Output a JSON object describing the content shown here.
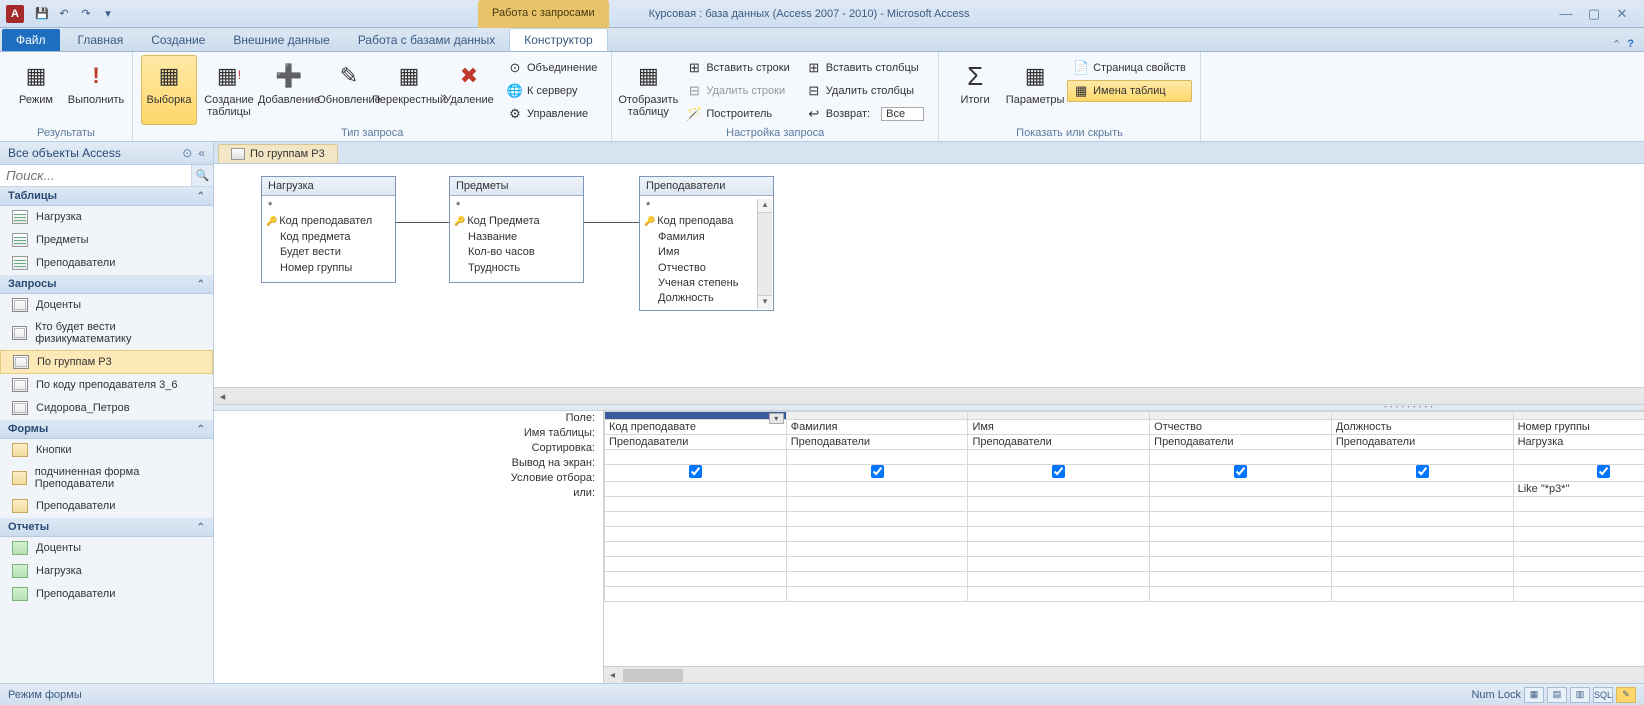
{
  "titlebar": {
    "app_letter": "A",
    "context_tab": "Работа с запросами",
    "title": "Курсовая : база данных (Access 2007 - 2010)  -  Microsoft Access"
  },
  "tabs": {
    "file": "Файл",
    "home": "Главная",
    "create": "Создание",
    "external": "Внешние данные",
    "dbtools": "Работа с базами данных",
    "design": "Конструктор"
  },
  "ribbon": {
    "results": {
      "view": "Режим",
      "run": "Выполнить",
      "label": "Результаты"
    },
    "qtype": {
      "select": "Выборка",
      "maketable": "Создание\nтаблицы",
      "append": "Добавление",
      "update": "Обновление",
      "crosstab": "Перекрестный",
      "delete": "Удаление",
      "union": "Объединение",
      "passthrough": "К серверу",
      "datadef": "Управление",
      "label": "Тип запроса"
    },
    "setup": {
      "showtable": "Отобразить\nтаблицу",
      "insrows": "Вставить строки",
      "delrows": "Удалить строки",
      "builder": "Построитель",
      "inscols": "Вставить столбцы",
      "delcols": "Удалить столбцы",
      "return": "Возврат:",
      "return_val": "Все",
      "label": "Настройка запроса"
    },
    "showhide": {
      "totals": "Итоги",
      "params": "Параметры",
      "propsheet": "Страница свойств",
      "tablenames": "Имена таблиц",
      "label": "Показать или скрыть"
    }
  },
  "nav": {
    "header": "Все объекты Access",
    "search_ph": "Поиск...",
    "cat_tables": "Таблицы",
    "cat_queries": "Запросы",
    "cat_forms": "Формы",
    "cat_reports": "Отчеты",
    "tables": [
      "Нагрузка",
      "Предметы",
      "Преподаватели"
    ],
    "queries": [
      "Доценты",
      "Кто будет вести физикуматематику",
      "По группам Р3",
      "По коду преподавателя 3_6",
      "Сидорова_Петров"
    ],
    "forms": [
      "Кнопки",
      "подчиненная форма Преподаватели",
      "Преподаватели"
    ],
    "reports": [
      "Доценты",
      "Нагрузка",
      "Преподаватели"
    ]
  },
  "doc": {
    "tab": "По группам Р3"
  },
  "canvas": {
    "t1": {
      "name": "Нагрузка",
      "star": "*",
      "f1": "Код преподавател",
      "f2": "Код предмета",
      "f3": "Будет вести",
      "f4": "Номер группы"
    },
    "t2": {
      "name": "Предметы",
      "star": "*",
      "f1": "Код Предмета",
      "f2": "Название",
      "f3": "Кол-во часов",
      "f4": "Трудность"
    },
    "t3": {
      "name": "Преподаватели",
      "star": "*",
      "f1": "Код преподава",
      "f2": "Фамилия",
      "f3": "Имя",
      "f4": "Отчество",
      "f5": "Ученая степень",
      "f6": "Должность"
    }
  },
  "grid": {
    "row_field": "Поле:",
    "row_table": "Имя таблицы:",
    "row_sort": "Сортировка:",
    "row_show": "Вывод на экран:",
    "row_crit": "Условие отбора:",
    "row_or": "или:",
    "cols": [
      {
        "field": "Код преподавате",
        "table": "Преподаватели",
        "show": true,
        "crit": ""
      },
      {
        "field": "Фамилия",
        "table": "Преподаватели",
        "show": true,
        "crit": ""
      },
      {
        "field": "Имя",
        "table": "Преподаватели",
        "show": true,
        "crit": ""
      },
      {
        "field": "Отчество",
        "table": "Преподаватели",
        "show": true,
        "crit": ""
      },
      {
        "field": "Должность",
        "table": "Преподаватели",
        "show": true,
        "crit": ""
      },
      {
        "field": "Номер группы",
        "table": "Нагрузка",
        "show": true,
        "crit": "Like \"*р3*\""
      },
      {
        "field": "",
        "table": "",
        "show": false,
        "crit": ""
      },
      {
        "field": "",
        "table": "",
        "show": false,
        "crit": ""
      },
      {
        "field": "",
        "table": "",
        "show": false,
        "crit": ""
      },
      {
        "field": "",
        "table": "",
        "show": false,
        "crit": ""
      },
      {
        "field": "",
        "table": "",
        "show": false,
        "crit": ""
      }
    ]
  },
  "status": {
    "left": "Режим формы",
    "numlock": "Num Lock",
    "sql": "SQL"
  }
}
